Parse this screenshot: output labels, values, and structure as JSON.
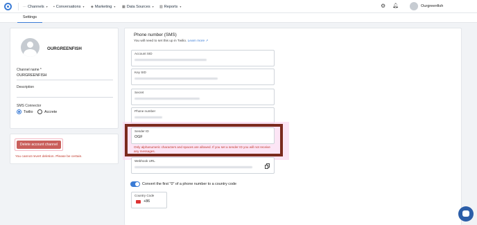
{
  "nav": {
    "items": [
      {
        "label": "Channels",
        "icon": "chat-dots-icon"
      },
      {
        "label": "Conversations",
        "icon": "chat-bubble-icon"
      },
      {
        "label": "Marketing",
        "icon": "broadcast-icon"
      },
      {
        "label": "Data Sources",
        "icon": "grid-icon"
      },
      {
        "label": "Reports",
        "icon": "bar-chart-icon"
      }
    ],
    "user_name": "Ourgreenfish"
  },
  "tabs": {
    "active": "Settings"
  },
  "profile": {
    "name": "OURGREENFISH",
    "channel_name_label": "Channel name *",
    "channel_name_value": "OURGREENFISH",
    "description_label": "Description",
    "description_value": "",
    "sms_connector_label": "SMS Connector",
    "options": [
      "Twilio",
      "Accrete"
    ],
    "selected": "Twilio"
  },
  "danger": {
    "button_label": "Delete account channel",
    "note": "You cannot revert deletion. Please be certain."
  },
  "sms": {
    "title": "Phone number (SMS)",
    "subtitle": "You will need to set this up in Twilio.",
    "learn_more": "Learn more",
    "fields": {
      "account_sid": "Account SID",
      "key_sid": "Key SID",
      "secret": "Secret",
      "phone_number": "Phone number",
      "sender_id": "Sender ID",
      "sender_id_value": "OGF",
      "sender_note": "Only alphanumeric characters and spaces are allowed. If you set a sender ID you will not receive any messages.",
      "webhook_url": "Webhook URL"
    },
    "toggle_label": "Convert the first \"0\" of a phone number to a country code",
    "toggle_on": true,
    "country_code_label": "Country Code",
    "country_code_value": "+86"
  },
  "colors": {
    "accent": "#3a7bd5",
    "danger": "#c95f5b",
    "highlight_frame": "#7b2a1d"
  }
}
